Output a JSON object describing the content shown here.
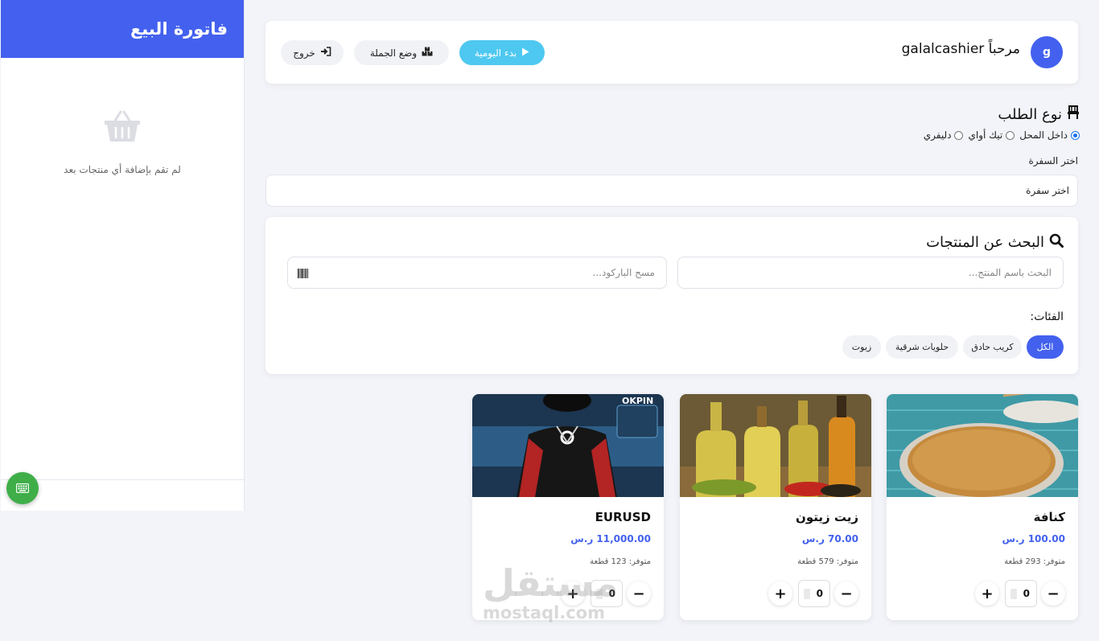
{
  "invoice": {
    "title": "فاتورة البيع",
    "empty_text": "لم تقم بإضافة أي منتجات بعد"
  },
  "header": {
    "avatar_letter": "g",
    "welcome": "مرحباً galalcashier",
    "start_day": "بدء اليومية",
    "wholesale": "وضع الجملة",
    "logout": "خروج"
  },
  "order": {
    "title": "نوع الطلب",
    "options": [
      "داخل المحل",
      "تيك أواي",
      "دليفري"
    ],
    "selected": "داخل المحل",
    "table_label": "اختر السفرة",
    "table_value": "اختر سفرة"
  },
  "search": {
    "title": "البحث عن المنتجات",
    "name_placeholder": "البحث باسم المنتج...",
    "barcode_placeholder": "مسح الباركود...",
    "categories_label": "الفئات:",
    "categories": [
      "الكل",
      "كريب حادق",
      "حلويات شرقية",
      "زيوت"
    ],
    "active_category": "الكل"
  },
  "products": [
    {
      "name": "كنافة",
      "price": "100.00 ر.س",
      "stock": "متوفر: 293 قطعة",
      "qty": "0",
      "image": "kunafa"
    },
    {
      "name": "زيت زيتون",
      "price": "70.00 ر.س",
      "stock": "متوفر: 579 قطعة",
      "qty": "0",
      "image": "olive-oil"
    },
    {
      "name": "EURUSD",
      "price": "11,000.00 ر.س",
      "stock": "متوفر: 123 قطعة",
      "qty": "0",
      "image": "robot-okpin"
    }
  ],
  "image_text": {
    "okpin": "OKPIN"
  },
  "watermark": {
    "arabic": "مستقل",
    "latin": "mostaql.com"
  },
  "colors": {
    "primary": "#4361ee",
    "info": "#4ec8f0",
    "success": "#3fae49"
  }
}
